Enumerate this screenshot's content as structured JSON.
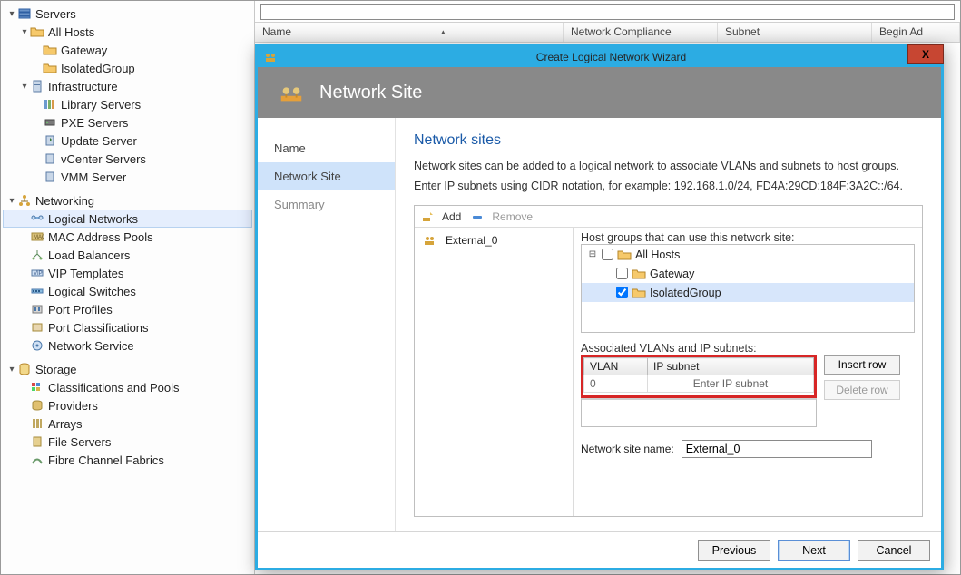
{
  "nav": {
    "servers": {
      "label": "Servers",
      "allhosts": "All Hosts",
      "gateway": "Gateway",
      "isolatedgroup": "IsolatedGroup",
      "infra": "Infrastructure",
      "library": "Library Servers",
      "pxe": "PXE Servers",
      "update": "Update Server",
      "vcenter": "vCenter Servers",
      "vmm": "VMM Server"
    },
    "networking": {
      "label": "Networking",
      "logical": "Logical Networks",
      "macpools": "MAC Address Pools",
      "loadbal": "Load Balancers",
      "vip": "VIP Templates",
      "logicalsw": "Logical Switches",
      "portprof": "Port Profiles",
      "portclass": "Port Classifications",
      "netsvc": "Network Service"
    },
    "storage": {
      "label": "Storage",
      "classpools": "Classifications and Pools",
      "providers": "Providers",
      "arrays": "Arrays",
      "fileservers": "File Servers",
      "fibre": "Fibre Channel Fabrics"
    }
  },
  "grid": {
    "cols": {
      "name": "Name",
      "netcomp": "Network Compliance",
      "subnet": "Subnet",
      "beginad": "Begin Ad"
    }
  },
  "wizard": {
    "title": "Create Logical Network Wizard",
    "header": "Network Site",
    "steps": {
      "name": "Name",
      "networksite": "Network Site",
      "summary": "Summary"
    },
    "content": {
      "h2": "Network sites",
      "line1": "Network sites can be added to a logical network to associate VLANs and subnets to host groups.",
      "line2": "Enter IP subnets using CIDR notation, for example: 192.168.1.0/24, FD4A:29CD:184F:3A2C::/64.",
      "toolbar": {
        "add": "Add",
        "remove": "Remove"
      },
      "sitelist": {
        "item0": "External_0"
      },
      "hostgroups": {
        "label": "Host groups that can use this network site:",
        "all": "All Hosts",
        "gateway": "Gateway",
        "isolated": "IsolatedGroup"
      },
      "vlans": {
        "label": "Associated VLANs and IP subnets:",
        "col_vlan": "VLAN",
        "col_ipsub": "IP subnet",
        "row0_vlan": "0",
        "row0_ip_placeholder": "Enter IP subnet",
        "insertrow": "Insert row",
        "deleterow": "Delete row"
      },
      "nsname_label": "Network site name:",
      "nsname_value": "External_0"
    },
    "footer": {
      "previous": "Previous",
      "next": "Next",
      "cancel": "Cancel"
    },
    "close_x": "X"
  },
  "colors": {
    "accent": "#2cace3",
    "highlight_red": "#d72626",
    "sel_blue": "#cfe3fa"
  }
}
